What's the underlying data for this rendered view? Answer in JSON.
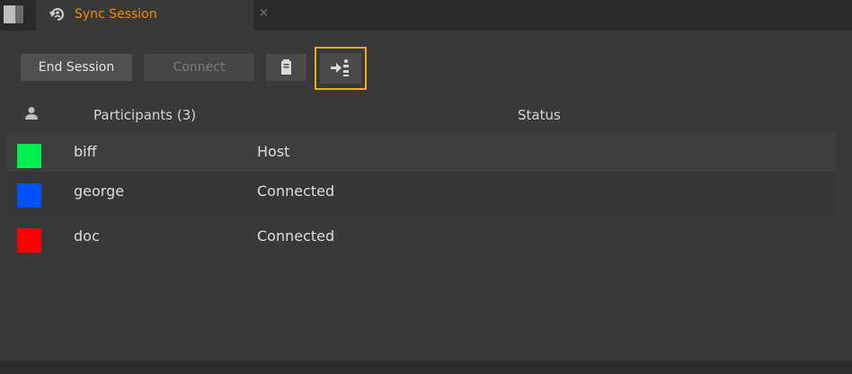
{
  "tab": {
    "title": "Sync Session",
    "icon": "sync-session-icon",
    "close_label": "×"
  },
  "toolbar": {
    "end_session_label": "End Session",
    "connect_label": "Connect",
    "clipboard_icon": "clipboard-icon",
    "follow_icon": "follow-session-icon"
  },
  "table": {
    "participants_header": "Participants (3)",
    "status_header": "Status",
    "rows": [
      {
        "name": "biff",
        "status": "Host",
        "color": "#00f050"
      },
      {
        "name": "george",
        "status": "Connected",
        "color": "#0050ff"
      },
      {
        "name": "doc",
        "status": "Connected",
        "color": "#ff0000"
      }
    ]
  },
  "colors": {
    "accent": "#f08c00",
    "highlight_border": "#f5a623"
  }
}
